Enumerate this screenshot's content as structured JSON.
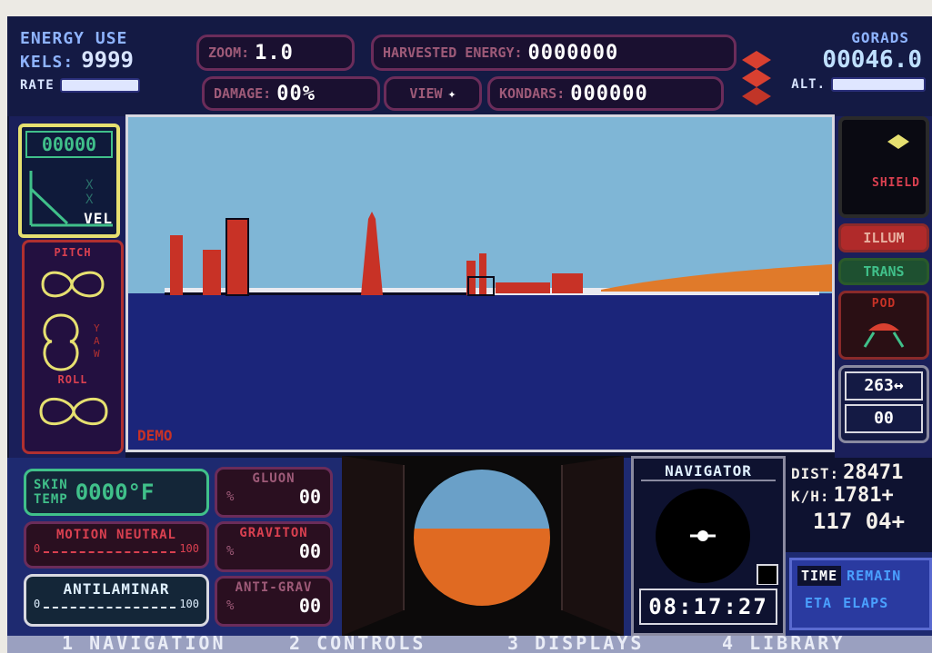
{
  "top": {
    "energy_use_label": "ENERGY USE",
    "kels_label": "KELS:",
    "kels_value": "9999",
    "rate_label": "RATE",
    "zoom_label": "ZOOM:",
    "zoom_value": "1.0",
    "harvested_label": "HARVESTED ENERGY:",
    "harvested_value": "0000000",
    "damage_label": "DAMAGE:",
    "damage_value": "00%",
    "view_label": "VIEW",
    "view_arrow": "✦",
    "kondars_label": "KONDARS:",
    "kondars_value": "000000",
    "gorads_label": "GORADS",
    "gorads_value": "00046.0",
    "alt_label": "ALT."
  },
  "left": {
    "counter": "00000",
    "vel_label": "VEL",
    "pitch_label": "PITCH",
    "yaw_label": "YAW",
    "roll_label": "ROLL"
  },
  "viewport": {
    "demo_label": "DEMO"
  },
  "right": {
    "shield_label": "SHIELD",
    "illum_label": "ILLUM",
    "trans_label": "TRANS",
    "pod_label": "POD",
    "heading_value": "263↔",
    "heading_sub": "00"
  },
  "bottom": {
    "skin_label_1": "SKIN",
    "skin_label_2": "TEMP",
    "skin_value": "0000°F",
    "motion_label": "MOTION NEUTRAL",
    "motion_scale_lo": "0",
    "motion_scale_hi": "100",
    "antilaminar_label": "ANTILAMINAR",
    "anti_scale_lo": "0",
    "anti_scale_hi": "100",
    "gluon_label": "GLUON",
    "gluon_value": "00",
    "graviton_label": "GRAVITON",
    "graviton_value": "00",
    "antigrav_label": "ANTI-GRAV",
    "antigrav_value": "00",
    "percent_sign": "%",
    "navigator_label": "NAVIGATOR",
    "clock": "08:17:27",
    "dist_label": "DIST:",
    "dist_value": "28471",
    "kh_label": "K/H:",
    "kh_value": "1781+",
    "coord_value": "117 04+",
    "time_label": "TIME",
    "remain_label": "REMAIN",
    "eta_label": "ETA",
    "elaps_label": "ELAPS"
  },
  "menu": {
    "item1": "1 NAVIGATION",
    "item2": "2 CONTROLS",
    "item3": "3 DISPLAYS",
    "item4": "4 LIBRARY"
  }
}
